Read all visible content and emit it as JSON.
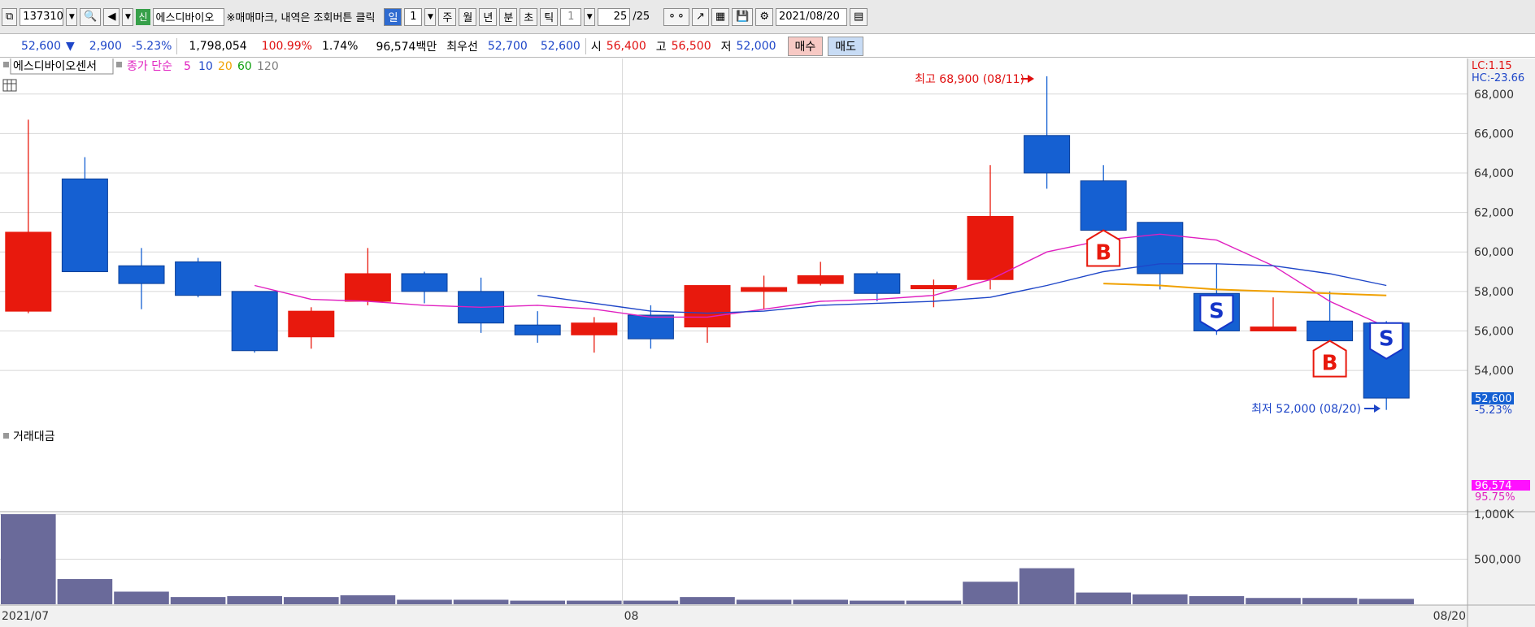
{
  "toolbar": {
    "code": "137310",
    "shin": "신",
    "stock_name": "에스디바이오",
    "mark_text": "※매매마크, 내역은 조회버튼 클릭",
    "period_day": "일",
    "period_count": "1",
    "week": "주",
    "month": "월",
    "year": "년",
    "minute": "분",
    "second": "초",
    "tick": "틱",
    "tick_count": "1",
    "page": "25",
    "page_total": "/25",
    "date": "2021/08/20"
  },
  "quote": {
    "price": "52,600",
    "change": "2,900",
    "change_pct": "-5.23%",
    "volume": "1,798,054",
    "volume_ratio": "100.99%",
    "turnover": "1.74%",
    "amount": "96,574백만",
    "best_label": "최우선",
    "best_ask": "52,700",
    "best_bid": "52,600",
    "open_label": "시",
    "open": "56,400",
    "high_label": "고",
    "high": "56,500",
    "low_label": "저",
    "low": "52,000",
    "buy_button": "매수",
    "sell_button": "매도"
  },
  "legend": {
    "stock_name": "에스디바이오센서",
    "ma_label": "종가 단순",
    "ma_periods": [
      "5",
      "10",
      "20",
      "60",
      "120"
    ],
    "colors": [
      "#e020c0",
      "#1e46c8",
      "#f0a000",
      "#10a010",
      "#808080"
    ]
  },
  "colors": {
    "up": "#e8190d",
    "down": "#1560d2",
    "volume": "#6a6a9a",
    "grid": "#d8d8d8",
    "axis_bg": "#f1f1f1"
  },
  "chart_data": {
    "type": "candlestick",
    "categories": [
      "2021/07",
      "",
      "",
      "",
      "",
      "",
      "",
      "",
      "",
      "",
      "",
      "08",
      "",
      "",
      "",
      "",
      "",
      "",
      "",
      "",
      "",
      "",
      "",
      "",
      "08/20"
    ],
    "ohlc": [
      [
        57000,
        66700,
        56900,
        61000
      ],
      [
        63700,
        64800,
        59000,
        59000
      ],
      [
        59300,
        60200,
        57100,
        58400
      ],
      [
        59500,
        59700,
        57700,
        57800
      ],
      [
        58000,
        58000,
        54900,
        55000
      ],
      [
        55700,
        57200,
        55100,
        57000
      ],
      [
        57500,
        60200,
        57300,
        58900
      ],
      [
        58900,
        59000,
        57400,
        58000
      ],
      [
        58000,
        58700,
        55900,
        56400
      ],
      [
        56300,
        57000,
        55400,
        55800
      ],
      [
        55800,
        56700,
        54900,
        56400
      ],
      [
        56800,
        57300,
        55100,
        55600
      ],
      [
        56200,
        58300,
        55400,
        58300
      ],
      [
        58000,
        58800,
        57100,
        58200
      ],
      [
        58400,
        59500,
        58300,
        58800
      ],
      [
        58900,
        59000,
        57500,
        57900
      ],
      [
        58200,
        58600,
        57200,
        58300
      ],
      [
        58600,
        64400,
        58100,
        61800
      ],
      [
        65900,
        68900,
        63200,
        64000
      ],
      [
        63600,
        64400,
        61000,
        61100
      ],
      [
        61500,
        61500,
        58100,
        58900
      ],
      [
        57900,
        59400,
        55800,
        56000
      ],
      [
        56000,
        57700,
        56000,
        56200
      ],
      [
        56500,
        58000,
        55400,
        55500
      ],
      [
        56400,
        56500,
        52000,
        52600
      ]
    ],
    "ma5": [
      null,
      null,
      null,
      null,
      58300,
      57600,
      57500,
      57300,
      57200,
      57300,
      57100,
      56700,
      56700,
      57100,
      57500,
      57600,
      57800,
      58600,
      60000,
      60600,
      60900,
      60600,
      59300,
      57500,
      56200
    ],
    "ma10": [
      null,
      null,
      null,
      null,
      null,
      null,
      null,
      null,
      null,
      57800,
      57400,
      57000,
      56900,
      57000,
      57300,
      57400,
      57500,
      57700,
      58300,
      59000,
      59400,
      59400,
      59300,
      58900,
      58300
    ],
    "ma20": [
      null,
      null,
      null,
      null,
      null,
      null,
      null,
      null,
      null,
      null,
      null,
      null,
      null,
      null,
      null,
      null,
      null,
      null,
      null,
      58400,
      58300,
      58100,
      58000,
      57900,
      57800
    ],
    "volume": [
      1000000,
      280000,
      140000,
      80000,
      90000,
      80000,
      100000,
      50000,
      50000,
      40000,
      40000,
      40000,
      80000,
      50000,
      50000,
      40000,
      40000,
      250000,
      400000,
      130000,
      110000,
      90000,
      70000,
      70000,
      60000
    ],
    "price_axis": [
      "68,000",
      "66,000",
      "64,000",
      "62,000",
      "60,000",
      "58,000",
      "56,000",
      "54,000"
    ],
    "volume_axis": [
      "1,000K",
      "500,000"
    ],
    "ylim": [
      51000,
      69800
    ],
    "trade_marks": [
      {
        "index": 19,
        "label": "B",
        "type": "buy",
        "price": 61100
      },
      {
        "index": 21,
        "label": "S",
        "type": "sell",
        "price": 57800
      },
      {
        "index": 23,
        "label": "B",
        "type": "buy",
        "price": 55500
      },
      {
        "index": 24,
        "label": "S",
        "type": "sell",
        "price": 56400
      }
    ],
    "high_annotation": "최고 68,900 (08/11)",
    "low_annotation": "최저 52,000 (08/20)",
    "lc": "LC:1.15",
    "hc": "HC:-23.66",
    "last_price": "52,600",
    "last_change": "-5.23%",
    "volume_title": "거래대금",
    "last_amount": "96,574",
    "last_amount_pct": "95.75%"
  }
}
